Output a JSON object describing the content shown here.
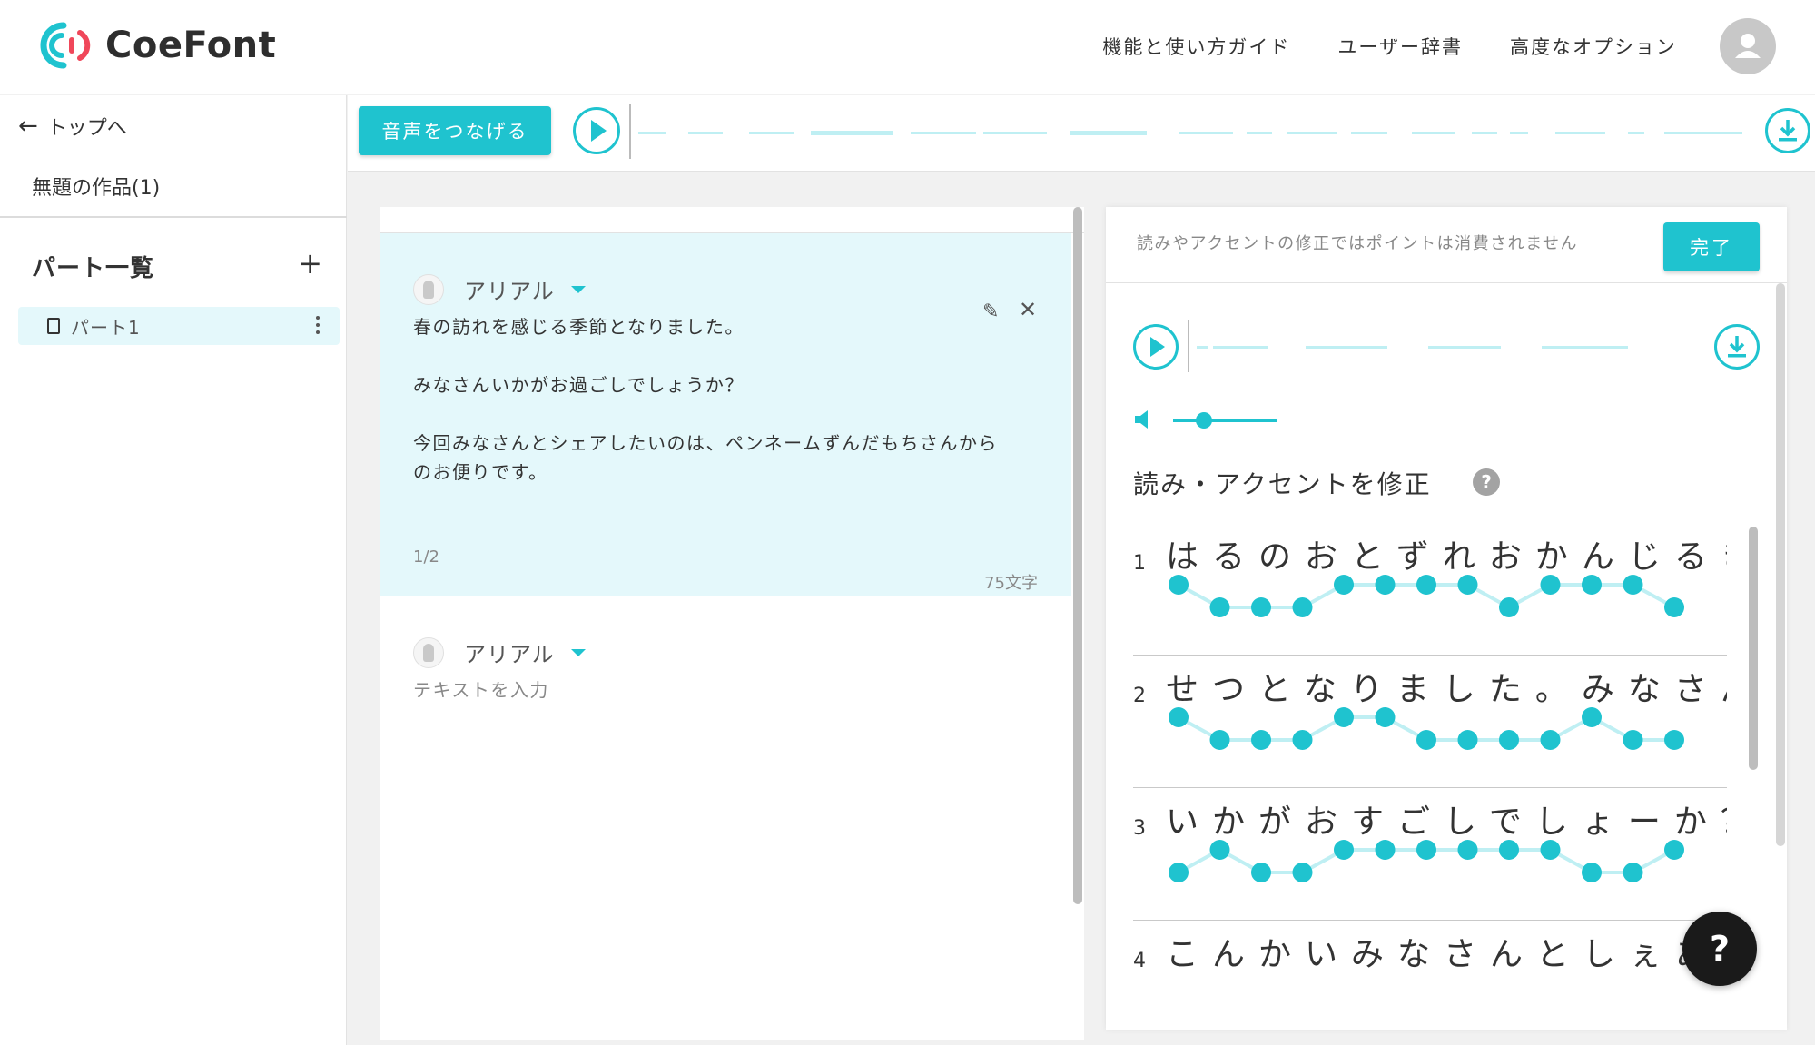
{
  "app": {
    "brand": "CoeFont"
  },
  "header": {
    "nav": [
      "機能と使い方ガイド",
      "ユーザー辞書",
      "高度なオプション"
    ]
  },
  "sidebar": {
    "back_label": "トップへ",
    "work_title": "無題の作品(1)",
    "parts_title": "パート一覧",
    "parts": [
      {
        "label": "パート1"
      }
    ]
  },
  "toolbar": {
    "connect_label": "音声をつなげる"
  },
  "editor": {
    "blocks": [
      {
        "voice": "アリアル",
        "lines": [
          "春の訪れを感じる季節となりました。",
          "みなさんいかがお過ごしでしょうか？",
          "今回みなさんとシェアしたいのは、ペンネームずんだもちさんから",
          "のお便りです。"
        ],
        "page": "1/2",
        "char_count": "75文字"
      },
      {
        "voice": "アリアル",
        "placeholder": "テキストを入力"
      }
    ]
  },
  "accent_panel": {
    "notice": "読みやアクセントの修正ではポイントは消費されません",
    "done_label": "完了",
    "title": "読み・アクセントを修正",
    "help_label": "?",
    "lines": [
      {
        "num": "1",
        "kana": "はるのおとずれおかんじるき",
        "pitch": [
          1,
          0,
          0,
          0,
          1,
          1,
          1,
          1,
          0,
          1,
          1,
          1,
          0
        ]
      },
      {
        "num": "2",
        "kana": "せつとなりました。みなさん",
        "pitch": [
          1,
          0,
          0,
          0,
          1,
          1,
          0,
          0,
          0,
          0,
          1,
          0,
          0
        ]
      },
      {
        "num": "3",
        "kana": "いかがおすごしでしょーか？",
        "pitch": [
          0,
          1,
          0,
          0,
          1,
          1,
          1,
          1,
          1,
          1,
          0,
          0,
          1
        ]
      },
      {
        "num": "4",
        "kana": "こんかいみなさんとしぇあし",
        "pitch": []
      }
    ]
  },
  "fab": {
    "label": "?"
  },
  "colors": {
    "accent": "#1fc3cf",
    "highlight": "#e4f8fb",
    "logo_red": "#f0475a"
  }
}
